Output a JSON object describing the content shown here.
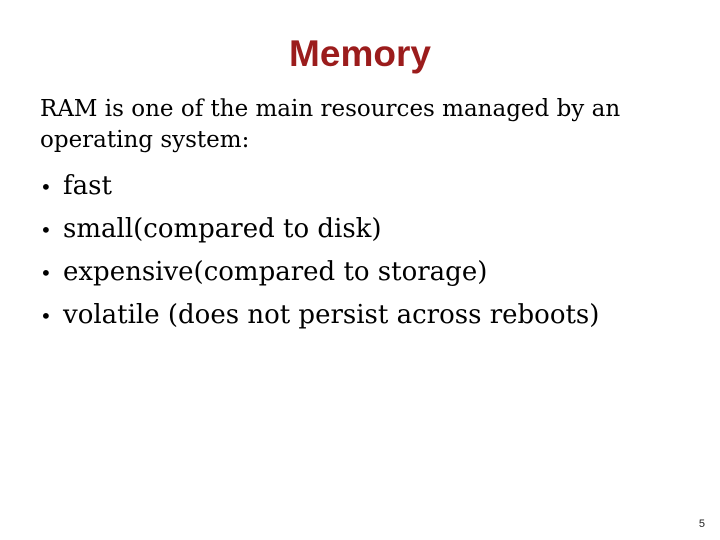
{
  "slide": {
    "title": "Memory",
    "title_color": "#9b1c1c",
    "intro": "RAM is one of the main resources managed by an operating system:",
    "bullet_glyph": "•",
    "bullets": [
      "fast",
      "small(compared to disk)",
      "expensive(compared to storage)",
      "volatile (does not persist across reboots)"
    ],
    "page_number": "5"
  }
}
